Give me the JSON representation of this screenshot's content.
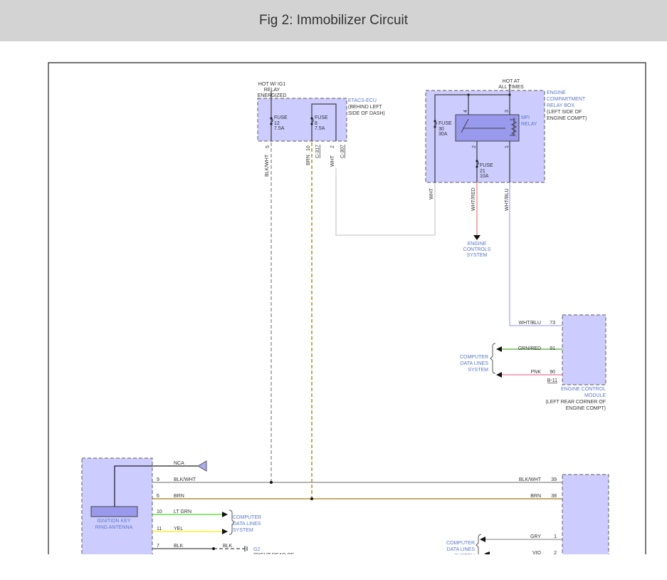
{
  "title": "Fig 2: Immobilizer Circuit",
  "colors": {
    "header_bg": "#d3d3d3",
    "component_fill": "#ccccff",
    "relay_fill": "#9999ee",
    "label_blue": "#5a78c8",
    "blk_wht": "#888888",
    "brn": "#a07a10",
    "wht": "#cccccc",
    "wht_red": "#f08080",
    "wht_blu": "#aaaaee",
    "grn_red": "#55aa33",
    "pnk": "#e87a9a",
    "lt_grn": "#44dd22",
    "yel": "#ffee00",
    "blk": "#444444",
    "gry": "#999999"
  },
  "etacs": {
    "hot1": "HOT W/ IG1",
    "hot2": "RELAY",
    "hot3": "ENERGIZED",
    "name": "ETACS-ECU",
    "loc1": "(BEHIND LEFT",
    "loc2": "SIDE OF DASH)",
    "fuse12": {
      "label": "FUSE",
      "num": "12",
      "amp": "7.5A"
    },
    "fuse8": {
      "label": "FUSE",
      "num": "8",
      "amp": "7.5A"
    },
    "pins": [
      "5",
      "10",
      "2"
    ],
    "conn1": "C-317",
    "conn2": "C-307",
    "wires": [
      "BLK/WHT",
      "BRN",
      "WHT"
    ]
  },
  "relay_box": {
    "hot1": "HOT AT",
    "hot2": "ALL TIMES",
    "name1": "ENGINE",
    "name2": "COMPARTMENT",
    "name3": "RELAY BOX",
    "loc1": "(LEFT SIDE OF",
    "loc2": "ENGINE COMPT)",
    "fuse30": {
      "label": "FUSE",
      "num": "30",
      "amp": "30A"
    },
    "fuse21": {
      "label": "FUSE",
      "num": "21",
      "amp": "10A"
    },
    "relay1": "MFI",
    "relay2": "RELAY",
    "pins": [
      "4",
      "3",
      "2",
      "1"
    ],
    "wires": [
      "WHT",
      "WHT/RED",
      "WHT/BLU"
    ],
    "ecs1": "ENGINE",
    "ecs2": "CONTROLS",
    "ecs3": "SYSTEM"
  },
  "ecm": {
    "rows": [
      {
        "wire": "WHT/BLU",
        "pin": "73"
      },
      {
        "wire": "GRN/RED",
        "pin": "91"
      },
      {
        "wire": "PNK",
        "pin": "90"
      }
    ],
    "conn": "B-11",
    "cdl1": "COMPUTER",
    "cdl2": "DATA LINES",
    "cdl3": "SYSTEM",
    "name1": "ENGINE CONTROL",
    "name2": "MODULE",
    "loc1": "(LEFT REAR CORNER OF",
    "loc2": "ENGINE COMPT)"
  },
  "antenna": {
    "name1": "IGNITION KEY",
    "name2": "RING ANTENNA",
    "nca": "NCA",
    "rows": [
      {
        "pin": "9",
        "wire": "BLK/WHT"
      },
      {
        "pin": "6",
        "wire": "BRN"
      },
      {
        "pin": "10",
        "wire": "LT GRN"
      },
      {
        "pin": "11",
        "wire": "YEL"
      },
      {
        "pin": "7",
        "wire": "BLK"
      }
    ],
    "cdl1": "COMPUTER",
    "cdl2": "DATA LINES",
    "cdl3": "SYSTEM",
    "ground_wire": "BLK",
    "ground": "G2",
    "ground_loc": "(RIGHT REAR OF"
  },
  "right_module": {
    "rows": [
      {
        "wire": "BLK/WHT",
        "pin": "39"
      },
      {
        "wire": "BRN",
        "pin": "38"
      },
      {
        "wire": "GRY",
        "pin": "1"
      },
      {
        "wire": "VIO",
        "pin": "2"
      }
    ],
    "cdl1": "COMPUTER",
    "cdl2": "DATA LINES",
    "cdl3": "SYSTEM"
  }
}
